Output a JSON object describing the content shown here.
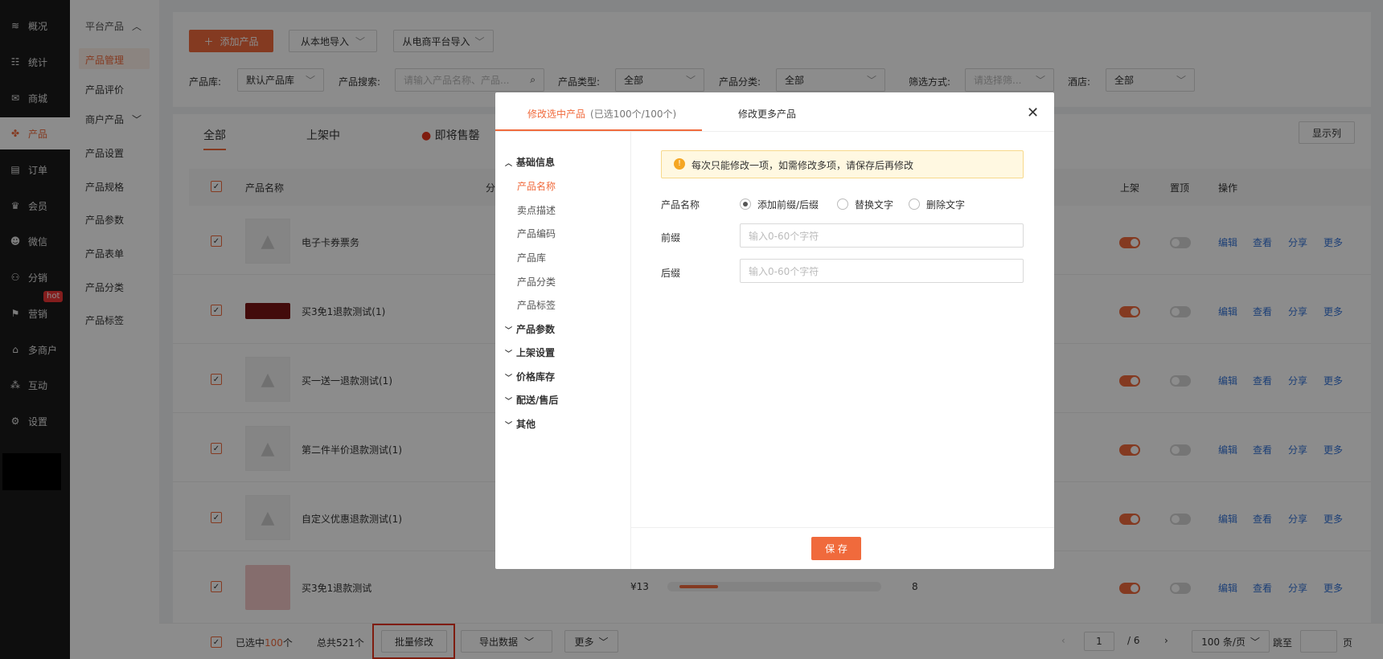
{
  "sidebar1": {
    "items": [
      {
        "label": "概况",
        "icon": "layers-icon",
        "glyph": "≋"
      },
      {
        "label": "统计",
        "icon": "chart-icon",
        "glyph": "☷"
      },
      {
        "label": "商城",
        "icon": "mail-icon",
        "glyph": "✉"
      },
      {
        "label": "产品",
        "icon": "grid-icon",
        "glyph": "✤"
      },
      {
        "label": "订单",
        "icon": "order-icon",
        "glyph": "▤"
      },
      {
        "label": "会员",
        "icon": "crown-icon",
        "glyph": "♛"
      },
      {
        "label": "微信",
        "icon": "wechat-icon",
        "glyph": "☻"
      },
      {
        "label": "分销",
        "icon": "user-share-icon",
        "glyph": "⚇"
      },
      {
        "label": "营销",
        "icon": "flag-icon",
        "glyph": "⚑",
        "badge": "hot"
      },
      {
        "label": "多商户",
        "icon": "shop-icon",
        "glyph": "⌂"
      },
      {
        "label": "互动",
        "icon": "interact-icon",
        "glyph": "⁂"
      },
      {
        "label": "设置",
        "icon": "gear-icon",
        "glyph": "⚙"
      }
    ]
  },
  "sidebar2": {
    "group1": "平台产品",
    "items": [
      "产品管理",
      "产品评价"
    ],
    "group2": "商户产品",
    "items2": [
      "产品设置",
      "产品规格",
      "产品参数",
      "产品表单",
      "产品分类",
      "产品标签"
    ]
  },
  "toolbar": {
    "add": "添加产品",
    "import_local": "从本地导入",
    "import_ecom": "从电商平台导入"
  },
  "filters": {
    "lib_label": "产品库:",
    "lib_value": "默认产品库",
    "search_label": "产品搜索:",
    "search_placeholder": "请输入产品名称、产品...",
    "type_label": "产品类型:",
    "type_value": "全部",
    "cat_label": "产品分类:",
    "cat_value": "全部",
    "filter_label": "筛选方式:",
    "filter_placeholder": "请选择筛...",
    "hotel_label": "酒店:",
    "hotel_value": "全部"
  },
  "tabs": {
    "all": "全部",
    "on": "上架中",
    "soon": "即将售罄",
    "columns": "显示列"
  },
  "table": {
    "headers": {
      "name": "产品名称",
      "cat": "分",
      "on": "上架",
      "top": "置顶",
      "ops": "操作"
    },
    "rows": [
      {
        "name": "电子卡券票务"
      },
      {
        "name": "买3免1退款测试(1)"
      },
      {
        "name": "买一送一退款测试(1)"
      },
      {
        "name": "第二件半价退款测试(1)"
      },
      {
        "name": "自定义优惠退款测试(1)"
      },
      {
        "name": "买3免1退款测试",
        "price": "¥13",
        "stock": "8"
      }
    ],
    "ops": {
      "edit": "编辑",
      "view": "查看",
      "share": "分享",
      "more": "更多"
    }
  },
  "bottombar": {
    "selected_prefix": "已选中",
    "selected_count": "100",
    "selected_suffix": "个",
    "total": "总共521个",
    "batch": "批量修改",
    "export": "导出数据",
    "more": "更多",
    "page": "1",
    "pages": "/ 6",
    "page_size": "100 条/页",
    "jump": "跳至",
    "page_unit": "页"
  },
  "modal": {
    "tab1": "修改选中产品",
    "tab1_note": "(已选100个/100个)",
    "tab2": "修改更多产品",
    "tree": {
      "basic": "基础信息",
      "basic_items": [
        "产品名称",
        "卖点描述",
        "产品编码",
        "产品库",
        "产品分类",
        "产品标签"
      ],
      "groups": [
        "产品参数",
        "上架设置",
        "价格库存",
        "配送/售后",
        "其他"
      ]
    },
    "notice": "每次只能修改一项，如需修改多项，请保存后再修改",
    "field_label": "产品名称",
    "radios": [
      "添加前缀/后缀",
      "替换文字",
      "删除文字"
    ],
    "prefix_label": "前缀",
    "prefix_placeholder": "输入0-60个字符",
    "suffix_label": "后缀",
    "suffix_placeholder": "输入0-60个字符",
    "save": "保 存"
  },
  "colors": {
    "accent": "#f06a3c",
    "link": "#3473d8",
    "sidebar": "#1a1a1a",
    "highlight": "#e8331d"
  }
}
